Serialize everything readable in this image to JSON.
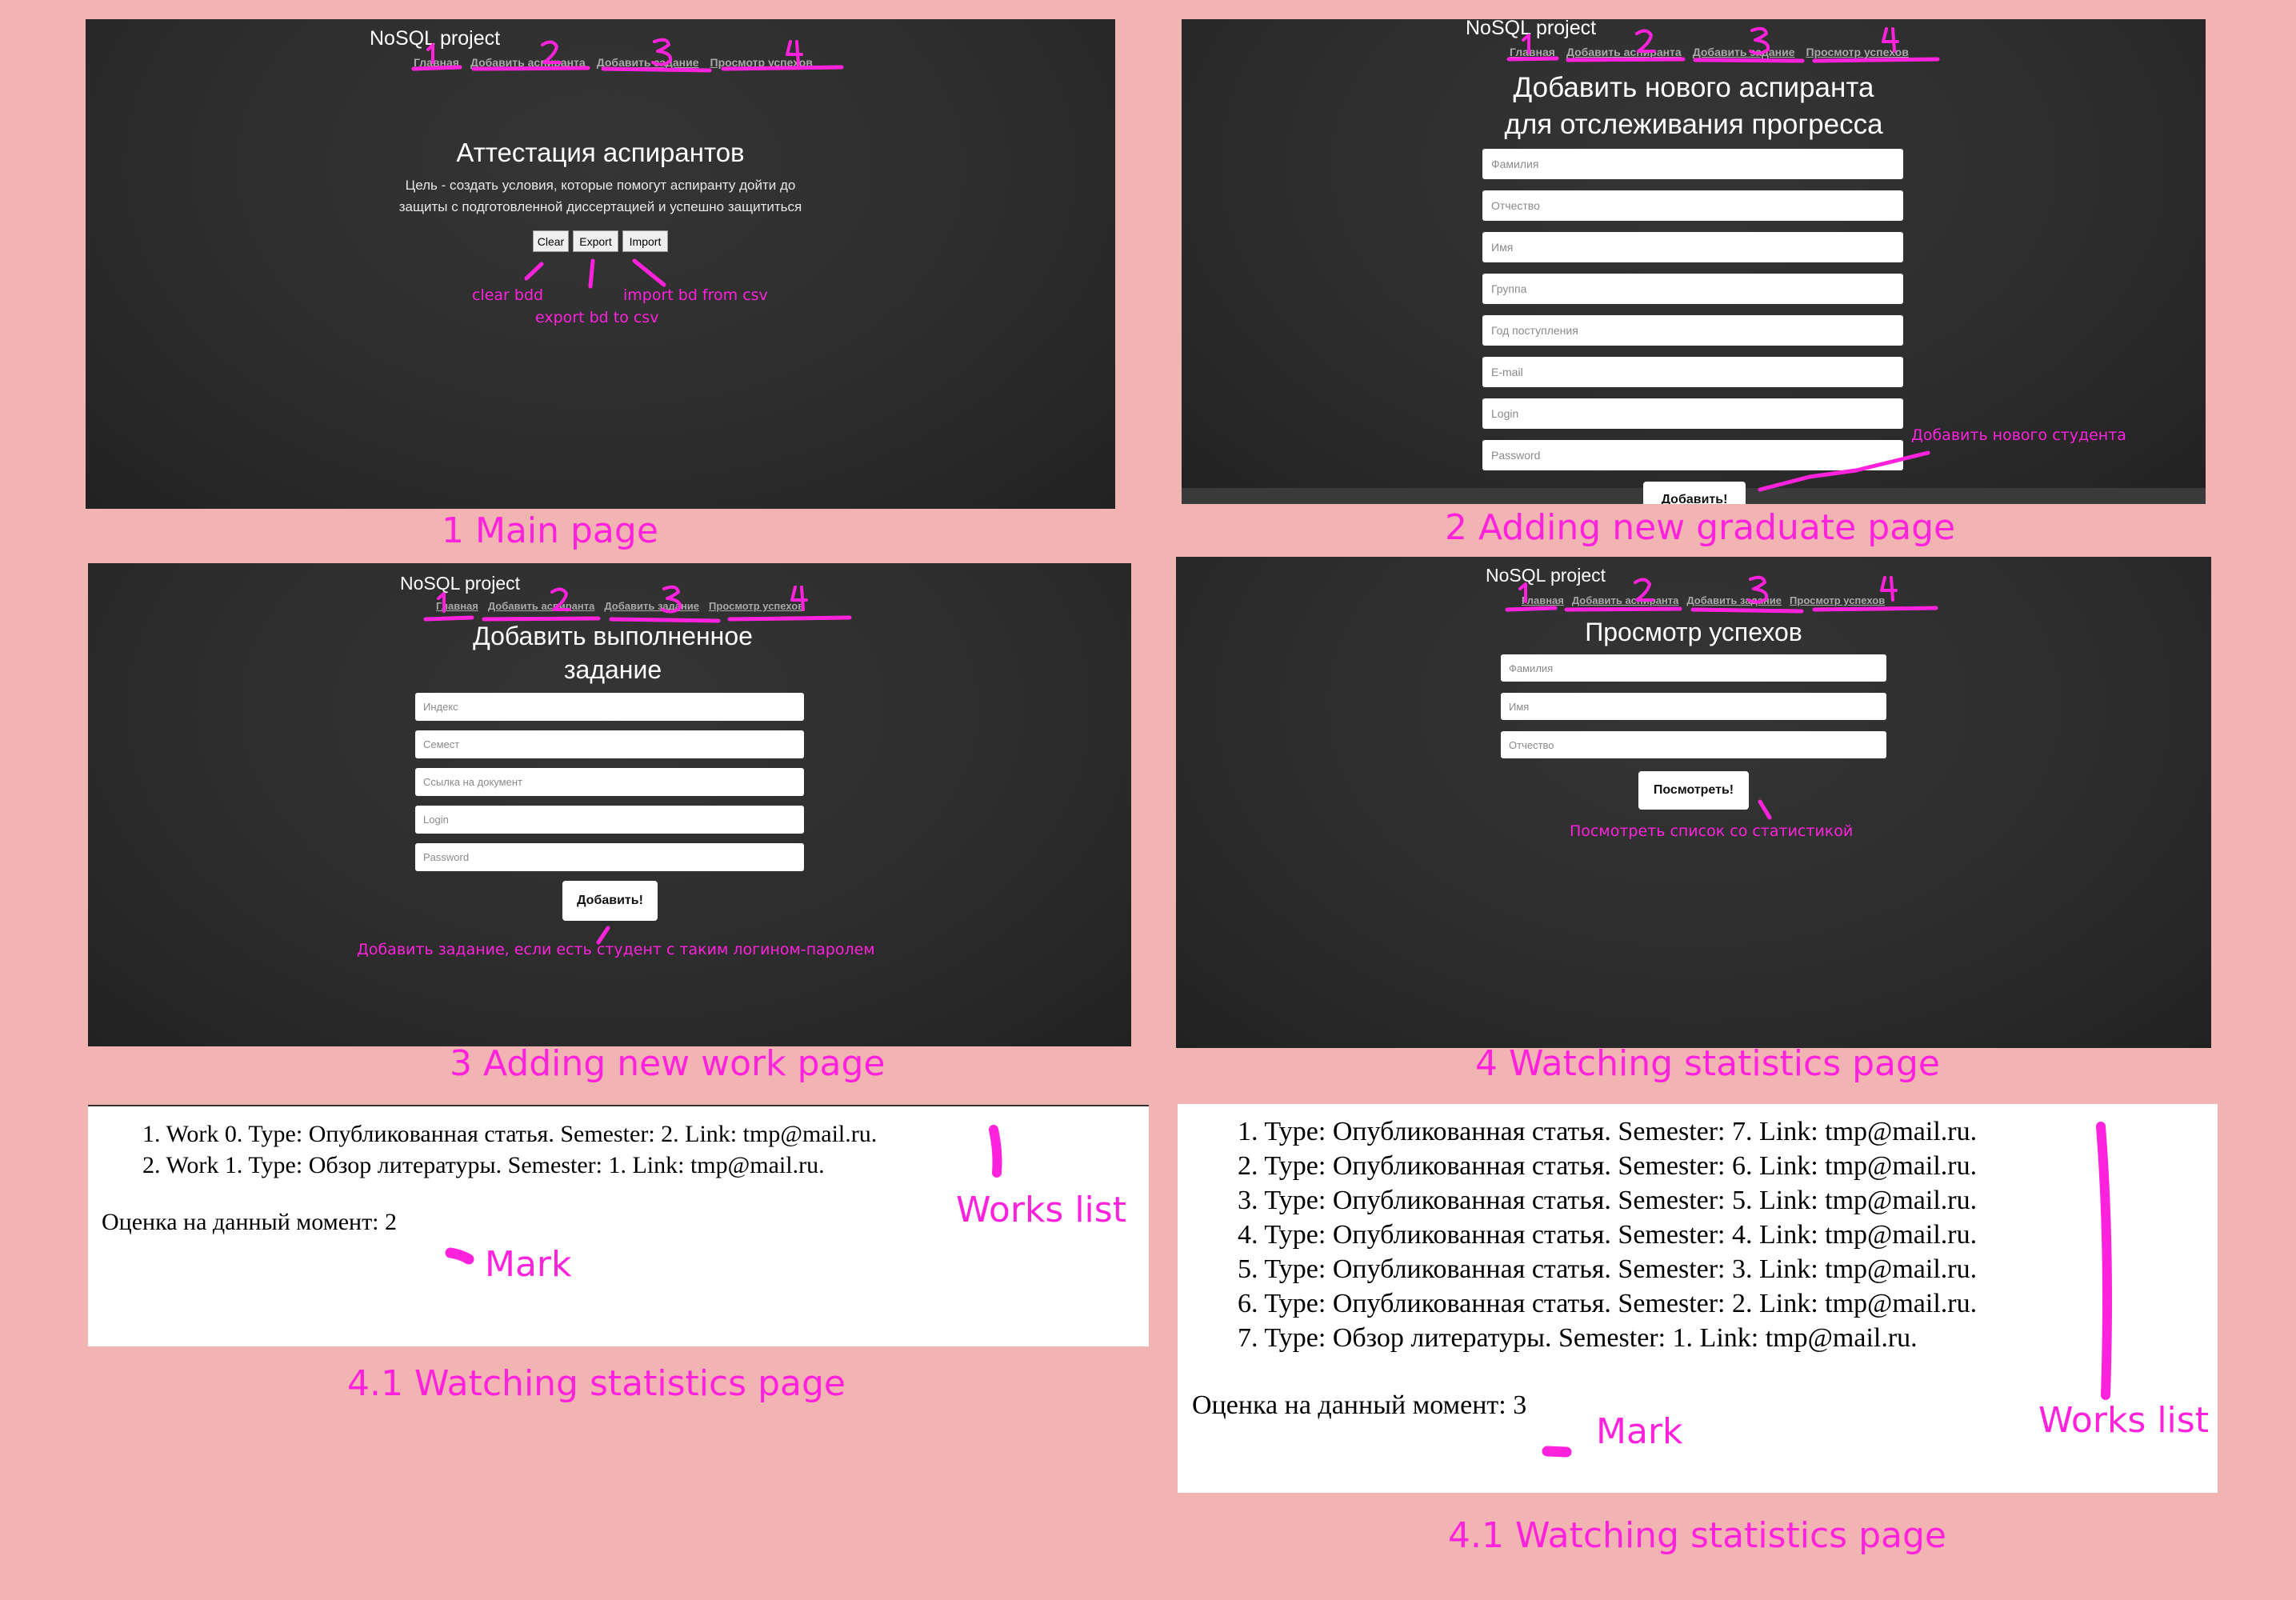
{
  "app": {
    "brand": "NoSQL project",
    "nav": [
      "Главная",
      "Добавить аспиранта",
      "Добавить задание",
      "Просмотр успехов"
    ],
    "nav_numbers": [
      "1",
      "2",
      "3",
      "4"
    ]
  },
  "main_page": {
    "title": "Аттестация аспирантов",
    "desc_line1": "Цель - создать условия, которые помогут аспиранту дойти до",
    "desc_line2": "защиты с подготовленной диссертацией и успешно защититься",
    "buttons": [
      "Clear",
      "Export",
      "Import"
    ],
    "notes": {
      "clear": "clear bdd",
      "import": "import bd from csv",
      "export": "export bd to csv"
    },
    "caption": "1 Main page"
  },
  "graduate_page": {
    "title_line1": "Добавить нового аспиранта",
    "title_line2": "для отслеживания прогресса",
    "fields": [
      "Фамилия",
      "Отчество",
      "Имя",
      "Группа",
      "Год поступления",
      "E-mail",
      "Login",
      "Password"
    ],
    "button": "Добавить!",
    "note": "Добавить нового студента",
    "caption": "2 Adding new graduate page"
  },
  "work_page": {
    "title_line1": "Добавить выполненное",
    "title_line2": "задание",
    "fields": [
      "Индекс",
      "Семест",
      "Ссылка на документ",
      "Login",
      "Password"
    ],
    "button": "Добавить!",
    "note": "Добавить задание, если есть студент с таким логином-паролем",
    "caption": "3 Adding new work page"
  },
  "stats_page": {
    "title": "Просмотр успехов",
    "fields": [
      "Фамилия",
      "Имя",
      "Отчество"
    ],
    "button": "Посмотреть!",
    "note": "Посмотреть список со статистикой",
    "caption": "4 Watching statistics page"
  },
  "result_a": {
    "items": [
      "1. Work 0. Type: Опубликованная статья. Semester: 2. Link: tmp@mail.ru.",
      "2. Work 1. Type: Обзор литературы. Semester: 1. Link: tmp@mail.ru."
    ],
    "mark": "Оценка на данный момент: 2",
    "label_works": "Works list",
    "label_mark": "Mark",
    "caption": "4.1 Watching statistics page"
  },
  "result_b": {
    "items": [
      "1. Type: Опубликованная статья. Semester: 7. Link: tmp@mail.ru.",
      "2. Type: Опубликованная статья. Semester: 6. Link: tmp@mail.ru.",
      "3. Type: Опубликованная статья. Semester: 5. Link: tmp@mail.ru.",
      "4. Type: Опубликованная статья. Semester: 4. Link: tmp@mail.ru.",
      "5. Type: Опубликованная статья. Semester: 3. Link: tmp@mail.ru.",
      "6. Type: Опубликованная статья. Semester: 2. Link: tmp@mail.ru.",
      "7. Type: Обзор литературы. Semester: 1. Link: tmp@mail.ru."
    ],
    "mark": "Оценка на данный момент: 3",
    "label_works": "Works list",
    "label_mark": "Mark",
    "caption": "4.1 Watching statistics page"
  },
  "colors": {
    "background": "#f2b3b3",
    "annotation": "#ff22dd",
    "panel": "#2e2e2e"
  }
}
